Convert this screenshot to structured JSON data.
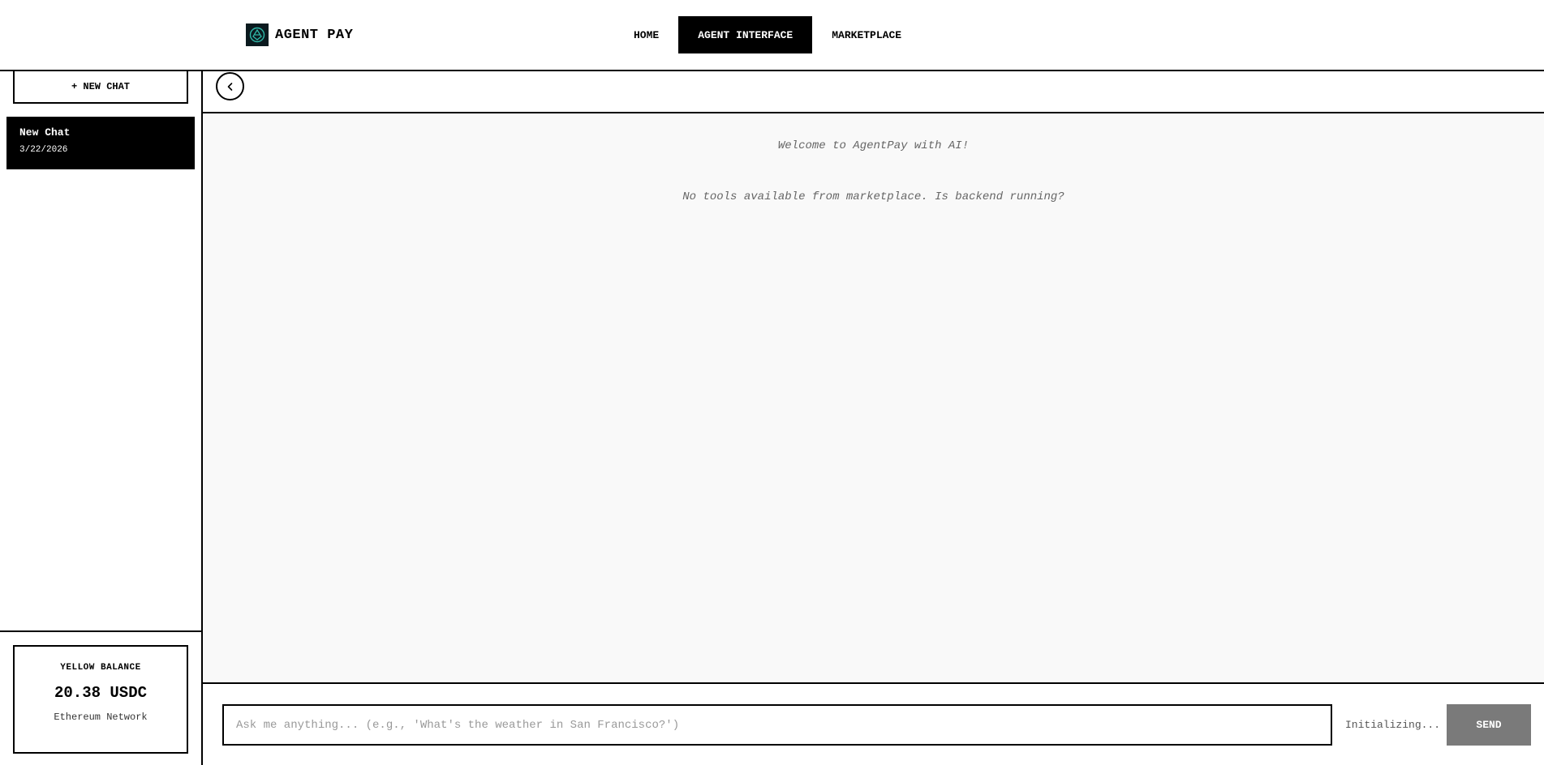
{
  "header": {
    "brand_name": "AGENT PAY",
    "nav": [
      {
        "label": "HOME",
        "active": false
      },
      {
        "label": "AGENT INTERFACE",
        "active": true
      },
      {
        "label": "MARKETPLACE",
        "active": false
      }
    ]
  },
  "sidebar": {
    "new_chat_label": "+ NEW CHAT",
    "chats": [
      {
        "title": "New Chat",
        "date": "3/22/2026",
        "selected": true
      }
    ],
    "balance": {
      "label": "YELLOW BALANCE",
      "amount": "20.38 USDC",
      "network": "Ethereum Network"
    }
  },
  "chat": {
    "messages": [
      "Welcome to AgentPay with AI!",
      "No tools available from marketplace. Is backend running?"
    ],
    "input_placeholder": "Ask me anything... (e.g., 'What's the weather in San Francisco?')",
    "input_value": "",
    "status": "Initializing...",
    "send_label": "SEND"
  },
  "colors": {
    "accent": "#000000",
    "chat_bg": "#f9f9f9",
    "send_disabled": "#7a7a7a",
    "logo_bg": "#0b1a1f",
    "logo_mark": "#2fb8a8"
  }
}
